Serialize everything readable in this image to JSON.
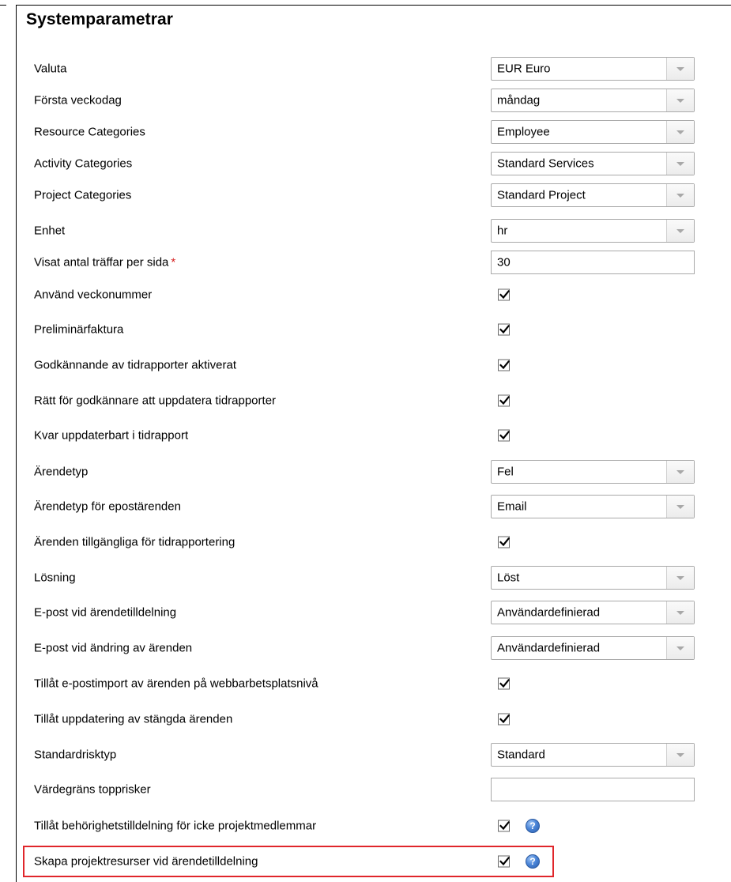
{
  "page": {
    "title": "Systemparametrar"
  },
  "rows": [
    {
      "type": "select",
      "label": "Valuta",
      "value": "EUR Euro"
    },
    {
      "type": "select",
      "label": "Första veckodag",
      "value": "måndag"
    },
    {
      "type": "select",
      "label": "Resource Categories",
      "value": "Employee"
    },
    {
      "type": "select",
      "label": "Activity Categories",
      "value": "Standard Services"
    },
    {
      "type": "select",
      "label": "Project Categories",
      "value": "Standard Project"
    },
    {
      "type": "select",
      "label": "Enhet",
      "value": "hr"
    },
    {
      "type": "text",
      "label": "Visat antal träffar per sida",
      "required_marker": "*",
      "value": "30"
    },
    {
      "type": "checkbox",
      "label": "Använd veckonummer",
      "checked": true
    },
    {
      "type": "checkbox",
      "label": "Preliminärfaktura",
      "checked": true
    },
    {
      "type": "checkbox",
      "label": "Godkännande av tidrapporter aktiverat",
      "checked": true
    },
    {
      "type": "checkbox",
      "label": "Rätt för godkännare att uppdatera tidrapporter",
      "checked": true
    },
    {
      "type": "checkbox",
      "label": "Kvar uppdaterbart i tidrapport",
      "checked": true
    },
    {
      "type": "select",
      "label": "Ärendetyp",
      "value": "Fel"
    },
    {
      "type": "select",
      "label": "Ärendetyp för epostärenden",
      "value": "Email"
    },
    {
      "type": "checkbox",
      "label": "Ärenden tillgängliga för tidrapportering",
      "checked": true
    },
    {
      "type": "select",
      "label": "Lösning",
      "value": "Löst"
    },
    {
      "type": "select",
      "label": "E-post vid ärendetilldelning",
      "value": "Användardefinierad"
    },
    {
      "type": "select",
      "label": "E-post vid ändring av ärenden",
      "value": "Användardefinierad"
    },
    {
      "type": "checkbox",
      "label": "Tillåt e-postimport av ärenden på webbarbetsplatsnivå",
      "checked": true
    },
    {
      "type": "checkbox",
      "label": "Tillåt uppdatering av stängda ärenden",
      "checked": true
    },
    {
      "type": "select",
      "label": "Standardrisktyp",
      "value": "Standard"
    },
    {
      "type": "text",
      "label": "Värdegräns topprisker",
      "value": ""
    },
    {
      "type": "checkbox",
      "label": "Tillåt behörighetstilldelning för icke projektmedlemmar",
      "checked": true,
      "help_icon": "question-help-icon"
    },
    {
      "type": "checkbox",
      "label": "Skapa projektresurser vid ärendetilldelning",
      "checked": true,
      "help_icon": "question-help-icon",
      "highlighted": true
    }
  ],
  "colors": {
    "highlight_border": "#e0262b",
    "required_marker": "#d62020",
    "help_icon": "#4c86d8"
  }
}
